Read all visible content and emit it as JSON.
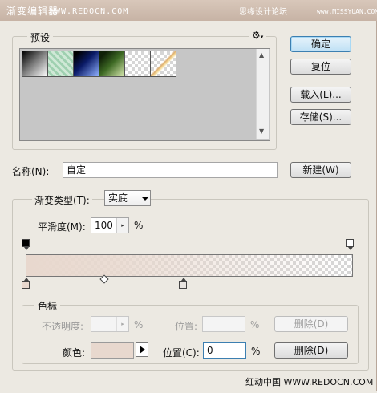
{
  "window": {
    "title": "渐变编辑器",
    "site_mark": "WWW.REDOCN.COM",
    "watermark_top": "思缘设计论坛",
    "watermark_top2": "www.MISSYUAN.COM"
  },
  "presets": {
    "label": "预设",
    "gear_label": "⚙",
    "swatches": [
      {
        "name": "black-white",
        "colors": [
          "#000000",
          "#ffffff"
        ]
      },
      {
        "name": "green-pattern",
        "colors": [
          "#cfe8d6",
          "#7fbf9a"
        ]
      },
      {
        "name": "blue-dark",
        "colors": [
          "#0a1a66",
          "#8fb0ff"
        ]
      },
      {
        "name": "green-dark",
        "colors": [
          "#1f3a12",
          "#bcd68a"
        ]
      },
      {
        "name": "transparent",
        "colors": [
          "#f0f0f0",
          "#d6d6d6"
        ]
      },
      {
        "name": "tan-transparent",
        "colors": [
          "#e8d8ce",
          "#ffffff"
        ]
      }
    ]
  },
  "buttons": {
    "ok": "确定",
    "reset": "复位",
    "load": "载入(L)...",
    "save": "存储(S)...",
    "new": "新建(W)",
    "delete_opacity": "删除(D)",
    "delete_color": "删除(D)"
  },
  "name": {
    "label": "名称(N):",
    "value": "自定"
  },
  "gradient": {
    "type_label": "渐变类型(T):",
    "type_value": "实底",
    "smooth_label": "平滑度(M):",
    "smooth_value": "100",
    "smooth_unit": "%",
    "start_color": "#e8d8ce",
    "colors": {
      "bar_accent": "#3c7fb1"
    }
  },
  "stops": {
    "group_label": "色标",
    "opacity_label": "不透明度:",
    "opacity_unit": "%",
    "opacity_location_label": "位置:",
    "opacity_location_unit": "%",
    "color_label": "颜色:",
    "color_swatch": "#e8d8ce",
    "location_label": "位置(C):",
    "location_value": "0",
    "location_unit": "%"
  },
  "footer": {
    "watermark": "红动中国 WWW.REDOCN.COM"
  }
}
